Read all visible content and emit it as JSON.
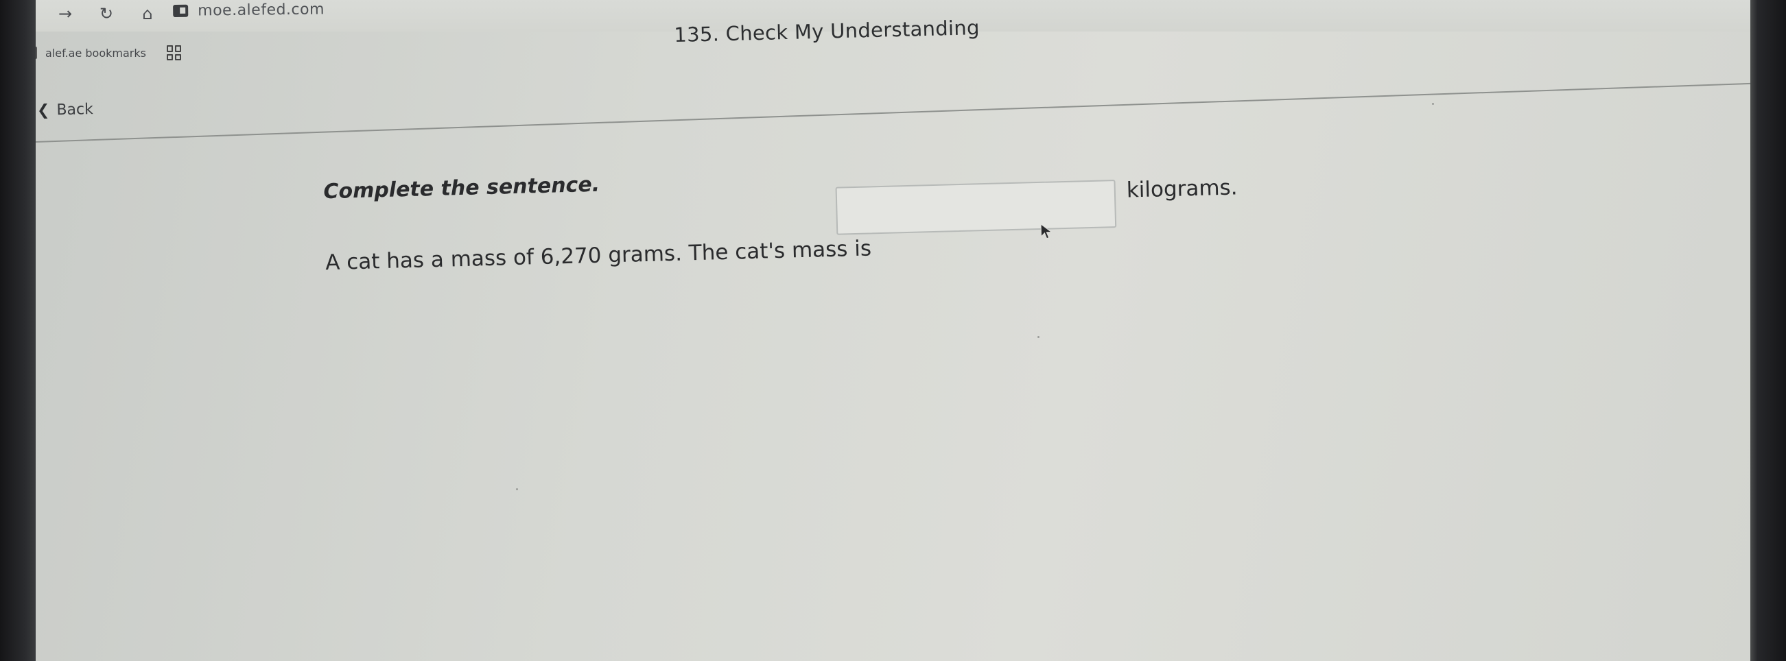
{
  "browser": {
    "nav": {
      "back_symbol": "←",
      "forward_symbol": "→",
      "reload_symbol": "↻",
      "home_symbol": "⌂"
    },
    "url": "moe.alefed.com",
    "bookmarks_label": "alef.ae bookmarks"
  },
  "page": {
    "title": "135. Check My Understanding",
    "back_label": "Back",
    "back_icon": "chevron-left-icon"
  },
  "question": {
    "instruction": "Complete the sentence.",
    "sentence_prefix": "A cat has a mass of 6,270 grams. The cat's mass is",
    "answer_value": "",
    "answer_placeholder": "",
    "unit": "kilograms."
  }
}
